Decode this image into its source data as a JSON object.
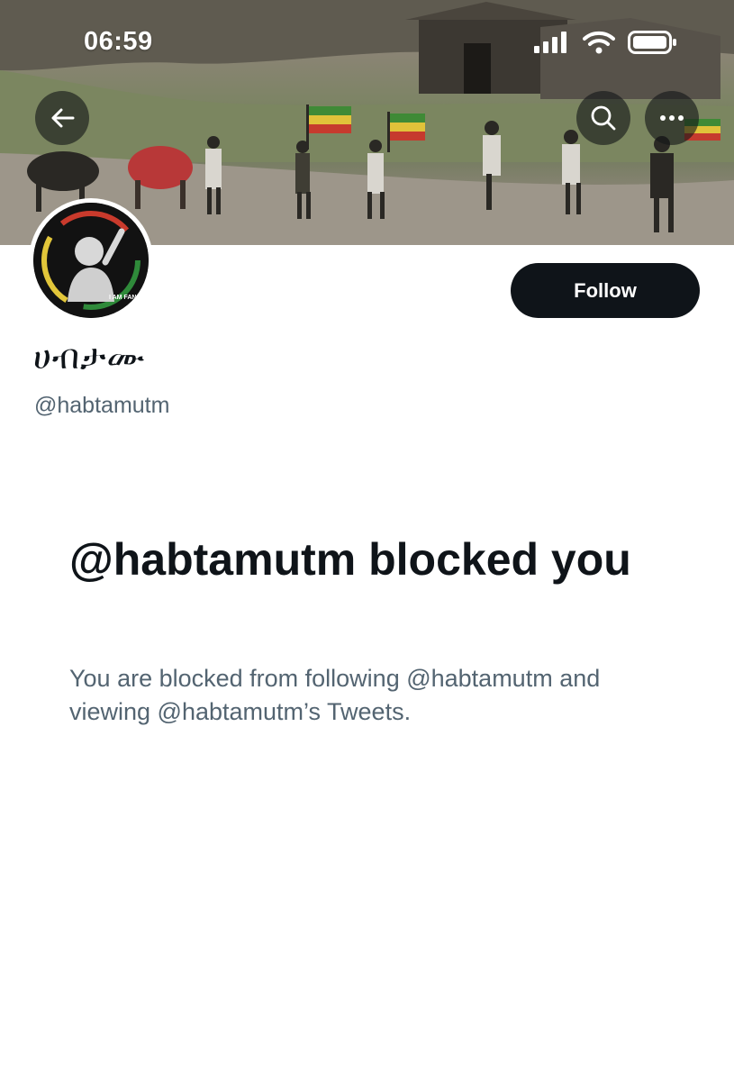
{
  "status_bar": {
    "time": "06:59",
    "icons": [
      "signal-icon",
      "wifi-icon",
      "battery-icon"
    ]
  },
  "banner": {
    "description_icons": [
      "back-arrow-icon",
      "search-icon",
      "more-icon"
    ]
  },
  "profile": {
    "display_name": "ሀብታሙ",
    "handle": "@habtamutm",
    "follow_label": "Follow",
    "avatar_caption": "I AM FANO"
  },
  "blocked": {
    "title": "@habtamutm blocked you",
    "description": "You are blocked from following @habtamutm and viewing @habtamutm’s Tweets."
  },
  "colors": {
    "primary_text": "#0f1419",
    "secondary_text": "#536471",
    "button_bg": "#0f1419",
    "button_text": "#ffffff"
  }
}
